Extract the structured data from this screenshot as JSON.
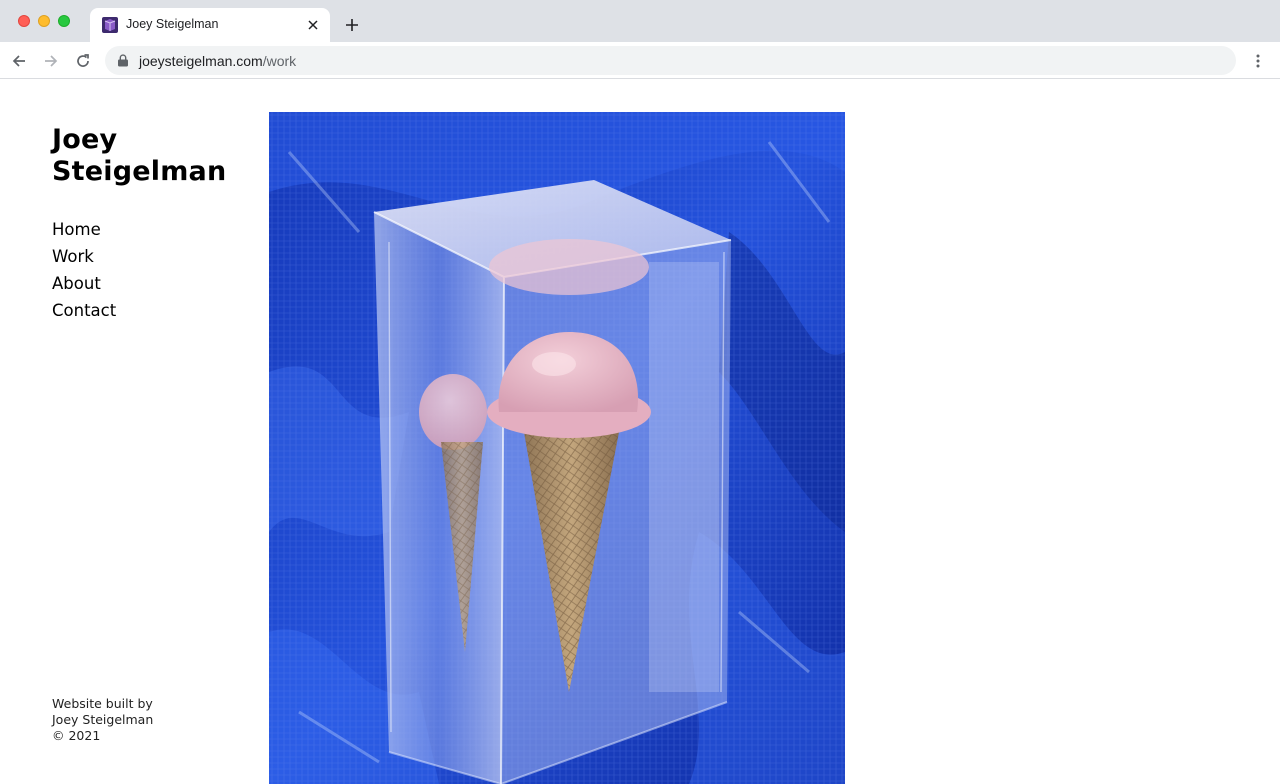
{
  "browser": {
    "tab": {
      "title": "Joey Steigelman",
      "favicon": "joey-steigelman-favicon",
      "close_icon": "close-icon"
    },
    "new_tab_icon": "plus-icon",
    "toolbar": {
      "back_icon": "arrow-left-icon",
      "forward_icon": "arrow-right-icon",
      "reload_icon": "reload-icon",
      "lock_icon": "lock-icon",
      "url_host": "joeysteigelman.com",
      "url_path": "/work",
      "menu_icon": "kebab-menu-icon"
    }
  },
  "site": {
    "title_line1": "Joey",
    "title_line2": "Steigelman",
    "nav": [
      {
        "label": "Home"
      },
      {
        "label": "Work"
      },
      {
        "label": "About"
      },
      {
        "label": "Contact"
      }
    ],
    "footer": {
      "line1": "Website built by",
      "line2": "Joey Steigelman",
      "line3": "© 2021"
    },
    "artwork_subject": "ice-cream-cones-in-acrylic-block"
  },
  "colors": {
    "tabstrip": "#dee1e6",
    "tarp_blue": "#1d3fc4",
    "ice_cream_pink": "#e8b4c4",
    "cone_tan": "#b89a72"
  }
}
